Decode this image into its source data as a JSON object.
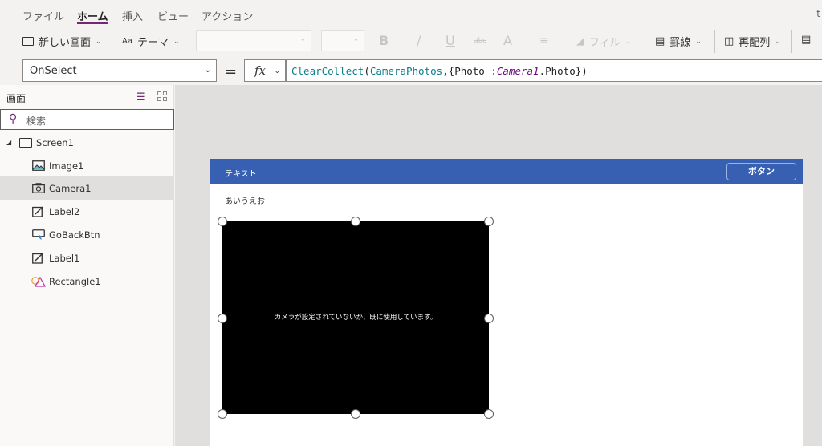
{
  "menu": {
    "items": [
      {
        "label": "ファイル",
        "active": false
      },
      {
        "label": "ホーム",
        "active": true
      },
      {
        "label": "挿入",
        "active": false
      },
      {
        "label": "ビュー",
        "active": false
      },
      {
        "label": "アクション",
        "active": false
      }
    ],
    "cut_text": "t"
  },
  "toolbar": {
    "new_screen_label": "新しい画面",
    "theme_label": "テーマ",
    "theme_icon_text": "Aa",
    "bold_label": "B",
    "italic_label": "/",
    "underline_label": "U",
    "strike_label": "abc",
    "font_color_label": "A",
    "fill_label": "フィル",
    "border_label": "罫線",
    "reorder_label": "再配列"
  },
  "formula": {
    "property": "OnSelect",
    "equals": "=",
    "fx_label": "fx",
    "tokens": {
      "fn": "ClearCollect",
      "open": "(",
      "collection": "CameraPhotos",
      "mid": ",{Photo :",
      "control": "Camera1",
      "end": ".Photo})"
    }
  },
  "tree": {
    "header": "画面",
    "search_placeholder": "検索",
    "items": [
      {
        "label": "Screen1",
        "icon": "screen-icon",
        "level": 0
      },
      {
        "label": "Image1",
        "icon": "image-icon",
        "level": 1
      },
      {
        "label": "Camera1",
        "icon": "camera-icon",
        "level": 1,
        "selected": true
      },
      {
        "label": "Label2",
        "icon": "label-icon",
        "level": 1
      },
      {
        "label": "GoBackBtn",
        "icon": "button-icon",
        "level": 1
      },
      {
        "label": "Label1",
        "icon": "label-icon",
        "level": 1
      },
      {
        "label": "Rectangle1",
        "icon": "shapes-icon",
        "level": 1
      }
    ]
  },
  "screen": {
    "header_text": "テキスト",
    "header_button": "ボタン",
    "label_text": "あいうえお",
    "camera_message": "カメラが設定されていないか、既に使用しています。"
  },
  "colors": {
    "accent": "#742774",
    "header_bar": "#3860b2",
    "camera_bg": "#000000",
    "formula_function": "#0b7e8b",
    "formula_control": "#6a0b7b"
  }
}
